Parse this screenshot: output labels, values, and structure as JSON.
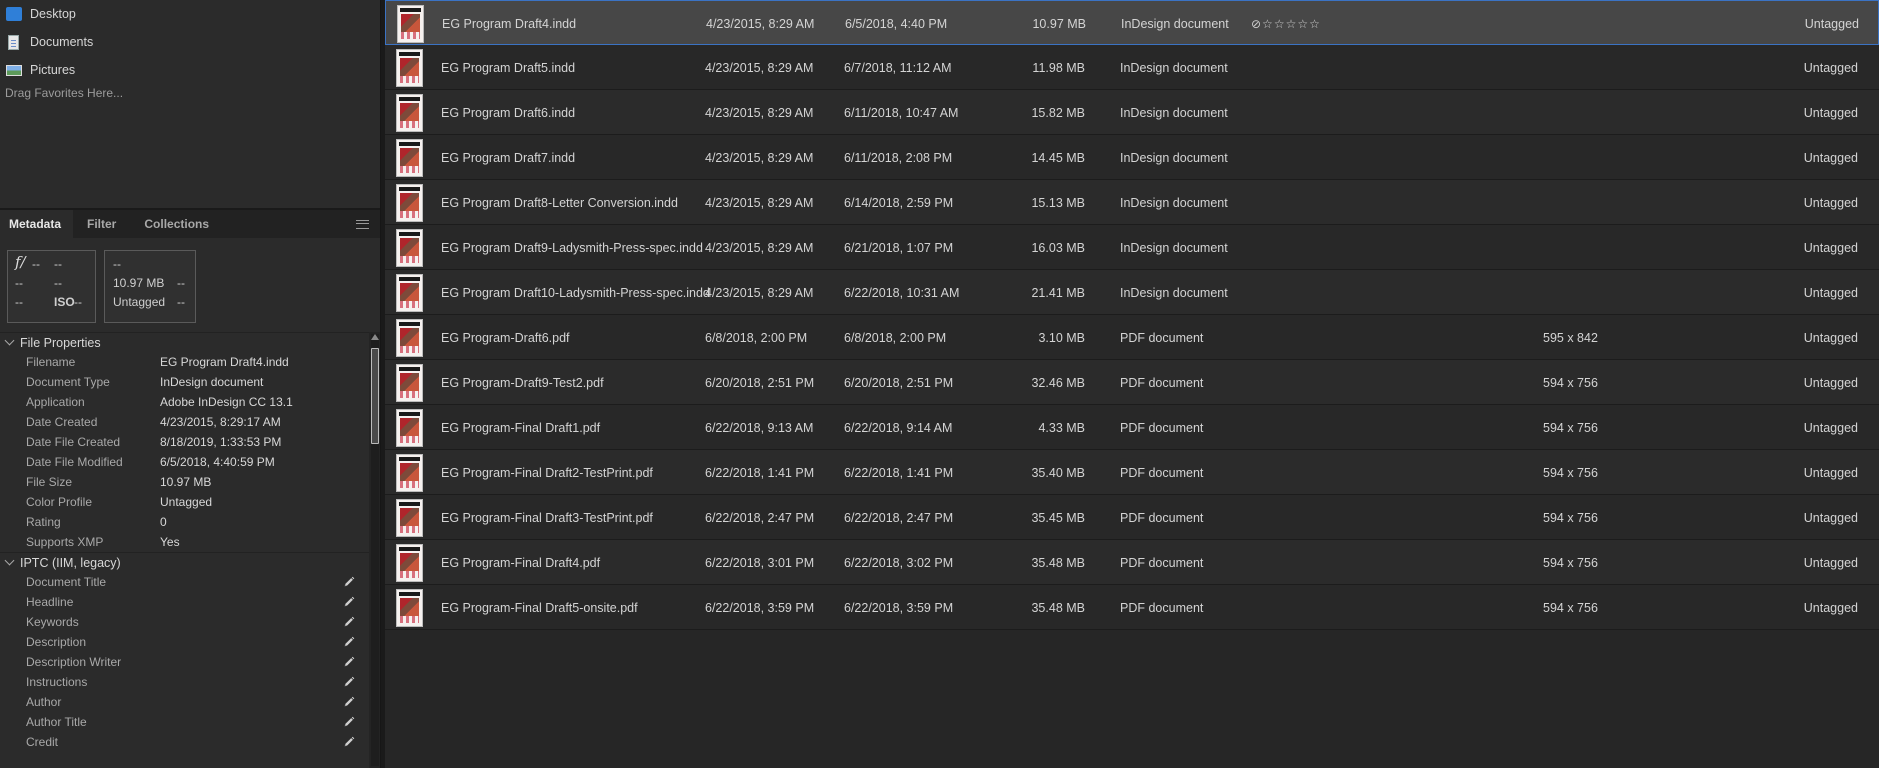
{
  "favorites": {
    "items": [
      {
        "label": "Desktop",
        "icon": "desktop-folder-icon"
      },
      {
        "label": "Documents",
        "icon": "document-icon"
      },
      {
        "label": "Pictures",
        "icon": "pictures-icon"
      }
    ],
    "drag_hint": "Drag Favorites Here..."
  },
  "panel_tabs": {
    "items": [
      "Metadata",
      "Filter",
      "Collections"
    ],
    "active": "Metadata"
  },
  "camera": {
    "fstop_symbol": "f/",
    "aperture": "--",
    "shutter": "--",
    "r2c1": "--",
    "r2c2": "--",
    "r3c1": "--",
    "iso_label": "ISO",
    "iso": "--",
    "dimensions": "--",
    "file_size": "10.97 MB",
    "file_size_extra": "--",
    "label": "Untagged",
    "label_extra": "--"
  },
  "file_properties": {
    "title": "File Properties",
    "rows": [
      {
        "key": "Filename",
        "value": "EG Program Draft4.indd"
      },
      {
        "key": "Document Type",
        "value": "InDesign document"
      },
      {
        "key": "Application",
        "value": "Adobe InDesign CC 13.1"
      },
      {
        "key": "Date Created",
        "value": "4/23/2015, 8:29:17 AM"
      },
      {
        "key": "Date File Created",
        "value": "8/18/2019, 1:33:53 PM"
      },
      {
        "key": "Date File Modified",
        "value": "6/5/2018, 4:40:59 PM"
      },
      {
        "key": "File Size",
        "value": "10.97 MB"
      },
      {
        "key": "Color Profile",
        "value": "Untagged"
      },
      {
        "key": "Rating",
        "value": "0"
      },
      {
        "key": "Supports XMP",
        "value": "Yes"
      }
    ]
  },
  "iptc": {
    "title": "IPTC (IIM, legacy)",
    "rows": [
      "Document Title",
      "Headline",
      "Keywords",
      "Description",
      "Description Writer",
      "Instructions",
      "Author",
      "Author Title",
      "Credit"
    ]
  },
  "files": [
    {
      "name": "EG Program Draft4.indd",
      "created": "4/23/2015, 8:29 AM",
      "modified": "6/5/2018, 4:40 PM",
      "size": "10.97 MB",
      "type": "InDesign document",
      "rating": "⊘☆☆☆☆☆",
      "dims": "",
      "label": "Untagged"
    },
    {
      "name": "EG Program Draft5.indd",
      "created": "4/23/2015, 8:29 AM",
      "modified": "6/7/2018, 11:12 AM",
      "size": "11.98 MB",
      "type": "InDesign document",
      "rating": "",
      "dims": "",
      "label": "Untagged"
    },
    {
      "name": "EG Program Draft6.indd",
      "created": "4/23/2015, 8:29 AM",
      "modified": "6/11/2018, 10:47 AM",
      "size": "15.82 MB",
      "type": "InDesign document",
      "rating": "",
      "dims": "",
      "label": "Untagged"
    },
    {
      "name": "EG Program Draft7.indd",
      "created": "4/23/2015, 8:29 AM",
      "modified": "6/11/2018, 2:08 PM",
      "size": "14.45 MB",
      "type": "InDesign document",
      "rating": "",
      "dims": "",
      "label": "Untagged"
    },
    {
      "name": "EG Program Draft8-Letter Conversion.indd",
      "created": "4/23/2015, 8:29 AM",
      "modified": "6/14/2018, 2:59 PM",
      "size": "15.13 MB",
      "type": "InDesign document",
      "rating": "",
      "dims": "",
      "label": "Untagged"
    },
    {
      "name": "EG Program Draft9-Ladysmith-Press-spec.indd",
      "created": "4/23/2015, 8:29 AM",
      "modified": "6/21/2018, 1:07 PM",
      "size": "16.03 MB",
      "type": "InDesign document",
      "rating": "",
      "dims": "",
      "label": "Untagged"
    },
    {
      "name": "EG Program Draft10-Ladysmith-Press-spec.indd",
      "created": "4/23/2015, 8:29 AM",
      "modified": "6/22/2018, 10:31 AM",
      "size": "21.41 MB",
      "type": "InDesign document",
      "rating": "",
      "dims": "",
      "label": "Untagged"
    },
    {
      "name": "EG Program-Draft6.pdf",
      "created": "6/8/2018, 2:00 PM",
      "modified": "6/8/2018, 2:00 PM",
      "size": "3.10 MB",
      "type": "PDF document",
      "rating": "",
      "dims": "595 x 842",
      "label": "Untagged"
    },
    {
      "name": "EG Program-Draft9-Test2.pdf",
      "created": "6/20/2018, 2:51 PM",
      "modified": "6/20/2018, 2:51 PM",
      "size": "32.46 MB",
      "type": "PDF document",
      "rating": "",
      "dims": "594 x 756",
      "label": "Untagged"
    },
    {
      "name": "EG Program-Final Draft1.pdf",
      "created": "6/22/2018, 9:13 AM",
      "modified": "6/22/2018, 9:14 AM",
      "size": "4.33 MB",
      "type": "PDF document",
      "rating": "",
      "dims": "594 x 756",
      "label": "Untagged"
    },
    {
      "name": "EG Program-Final Draft2-TestPrint.pdf",
      "created": "6/22/2018, 1:41 PM",
      "modified": "6/22/2018, 1:41 PM",
      "size": "35.40 MB",
      "type": "PDF document",
      "rating": "",
      "dims": "594 x 756",
      "label": "Untagged"
    },
    {
      "name": "EG Program-Final Draft3-TestPrint.pdf",
      "created": "6/22/2018, 2:47 PM",
      "modified": "6/22/2018, 2:47 PM",
      "size": "35.45 MB",
      "type": "PDF document",
      "rating": "",
      "dims": "594 x 756",
      "label": "Untagged"
    },
    {
      "name": "EG Program-Final Draft4.pdf",
      "created": "6/22/2018, 3:01 PM",
      "modified": "6/22/2018, 3:02 PM",
      "size": "35.48 MB",
      "type": "PDF document",
      "rating": "",
      "dims": "594 x 756",
      "label": "Untagged"
    },
    {
      "name": "EG Program-Final Draft5-onsite.pdf",
      "created": "6/22/2018, 3:59 PM",
      "modified": "6/22/2018, 3:59 PM",
      "size": "35.48 MB",
      "type": "PDF document",
      "rating": "",
      "dims": "594 x 756",
      "label": "Untagged"
    }
  ],
  "colors": {
    "selection_border": "#3b73c4",
    "panel_bg": "#2b2b2b"
  }
}
